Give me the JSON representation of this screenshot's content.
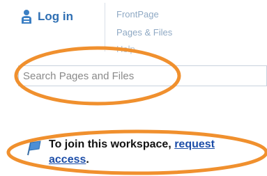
{
  "header": {
    "login_label": "Log in",
    "login_icon": "user-icon",
    "nav": [
      "FrontPage",
      "Pages & Files",
      "Help"
    ]
  },
  "search": {
    "placeholder": "Search Pages and Files",
    "value": ""
  },
  "notice": {
    "icon": "flag-icon",
    "text": "To join this workspace, ",
    "link_part1": "request",
    "link_part2": "access",
    "suffix": "."
  },
  "colors": {
    "link_blue": "#2f6fb3",
    "annotation_orange": "#f0902e"
  }
}
